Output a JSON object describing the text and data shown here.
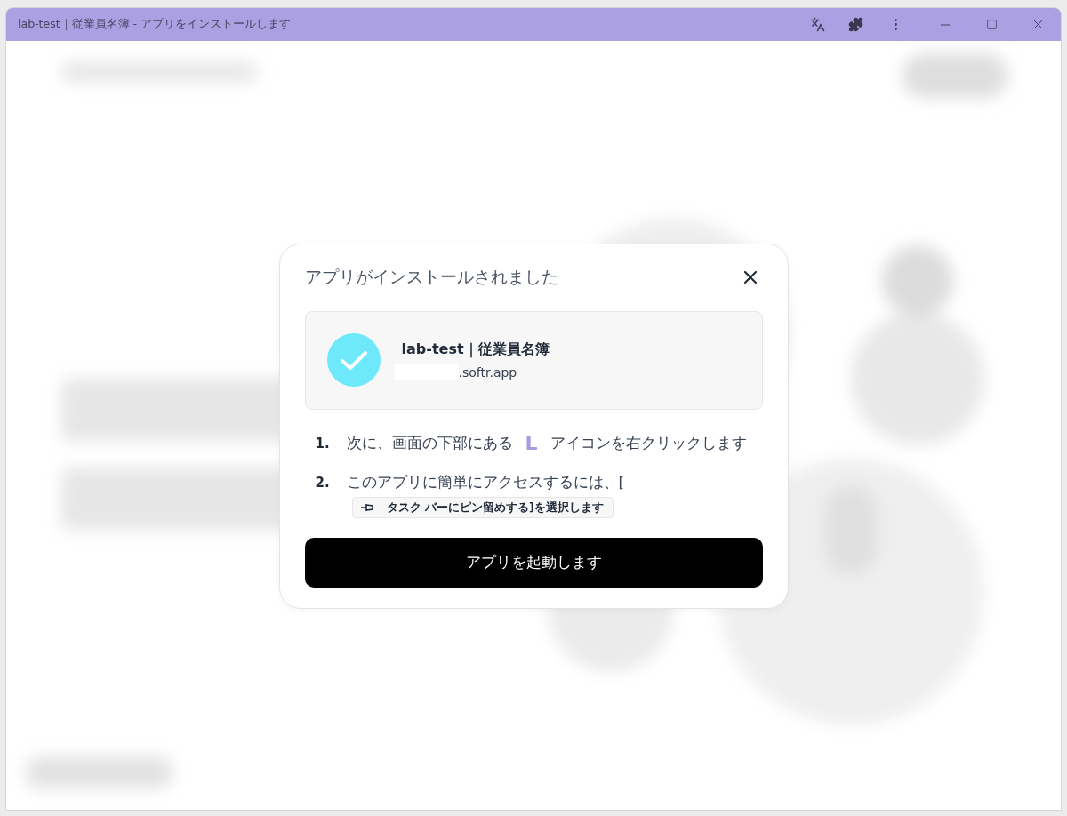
{
  "window": {
    "title": "lab-test｜従業員名簿 - アプリをインストールします"
  },
  "dialog": {
    "title": "アプリがインストールされました",
    "app": {
      "name": "lab-test｜従業員名簿",
      "domain": ".softr.app"
    },
    "steps": [
      {
        "kind": "icon",
        "number": "1.",
        "before": "次に、画面の下部にある",
        "icon_letter": "L",
        "after": "アイコンを右クリックします"
      },
      {
        "kind": "chip",
        "number": "2.",
        "text": "このアプリに簡単にアクセスするには、[",
        "chip": "タスク バーにピン留めする]を選択します"
      }
    ],
    "button": "アプリを起動します"
  }
}
